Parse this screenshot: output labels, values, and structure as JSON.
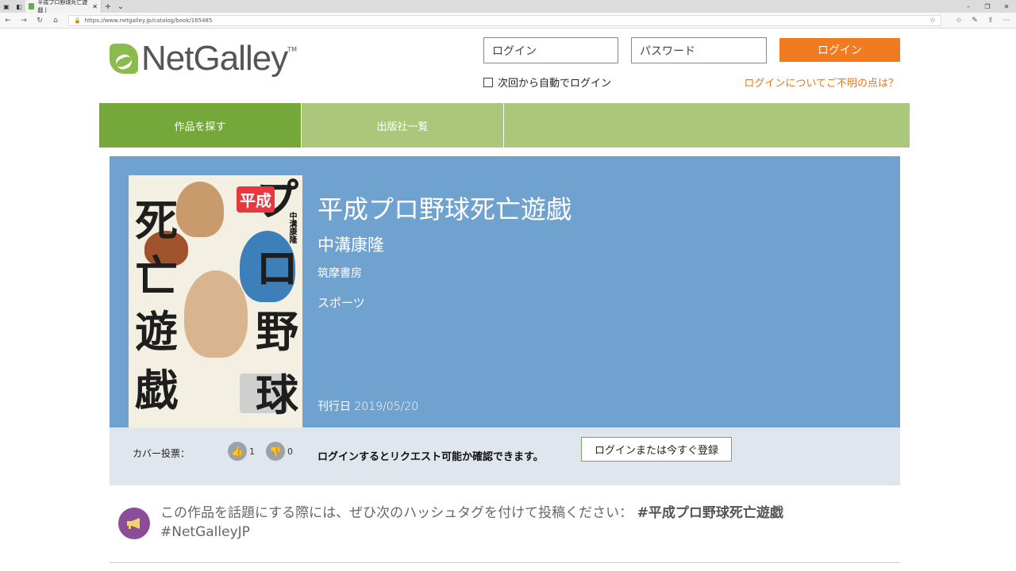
{
  "browser": {
    "tab_title": "平成プロ野球死亡遊戯 |",
    "url": "https://www.netgalley.jp/catalog/book/165485"
  },
  "header": {
    "logo_text": "NetGalley",
    "logo_tm": "TM",
    "username_placeholder": "ログイン",
    "password_placeholder": "パスワード",
    "login_button": "ログイン",
    "remember_label": "次回から自動でログイン",
    "help_link": "ログインについてご不明の点は？"
  },
  "nav": {
    "items": [
      {
        "label": "作品を探す"
      },
      {
        "label": "出版社一覧"
      }
    ]
  },
  "book": {
    "title": "平成プロ野球死亡遊戯",
    "author": "中溝康隆",
    "publisher": "筑摩書房",
    "category": "スポーツ",
    "release_label": "刊行日",
    "release_date": "2019/05/20",
    "cover_lettering": [
      "死",
      "亡",
      "遊",
      "戯",
      "プ",
      "ロ",
      "野",
      "球"
    ],
    "cover_badge": "平成",
    "cover_author": "中溝康隆"
  },
  "votes": {
    "label": "カバー投票：",
    "up_count": "1",
    "down_count": "0"
  },
  "request": {
    "message": "ログインするとリクエスト可能か確認できます。",
    "button": "ログインまたは今すぐ登録"
  },
  "hashtag": {
    "text": "この作品を話題にする際には、ぜひ次のハッシュタグを付けて投稿ください：",
    "tag1": "#平成プロ野球死亡遊戯",
    "tag2": "#NetGalleyJP"
  },
  "colors": {
    "accent_orange": "#f07b21",
    "nav_active": "#74a83b",
    "nav_bg": "#abc77b",
    "panel_blue": "#70a2cf",
    "hashtag_icon": "#8b4d9a"
  }
}
